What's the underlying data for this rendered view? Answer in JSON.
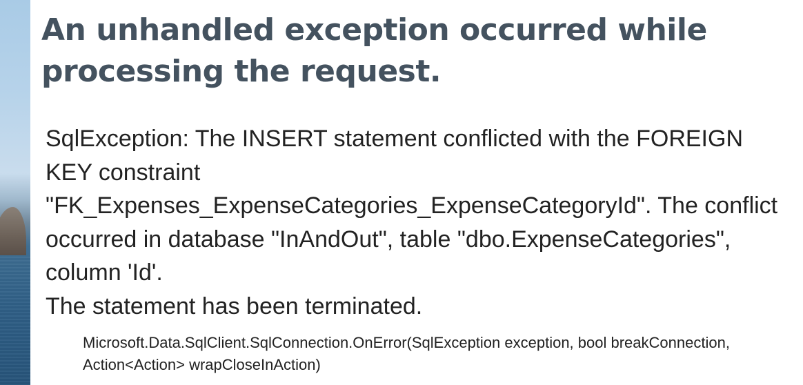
{
  "error_page": {
    "title": "An unhandled exception occurred while processing the request.",
    "exception_message": "SqlException: The INSERT statement conflicted with the FOREIGN KEY constraint \"FK_Expenses_ExpenseCategories_ExpenseCategoryId\". The conflict occurred in database \"InAndOut\", table \"dbo.ExpenseCategories\", column 'Id'.\nThe statement has been terminated.",
    "stack_frame": "Microsoft.Data.SqlClient.SqlConnection.OnError(SqlException exception, bool breakConnection, Action<Action> wrapCloseInAction)"
  },
  "colors": {
    "title": "#44525f",
    "body_text": "#222222",
    "background": "#ffffff"
  }
}
